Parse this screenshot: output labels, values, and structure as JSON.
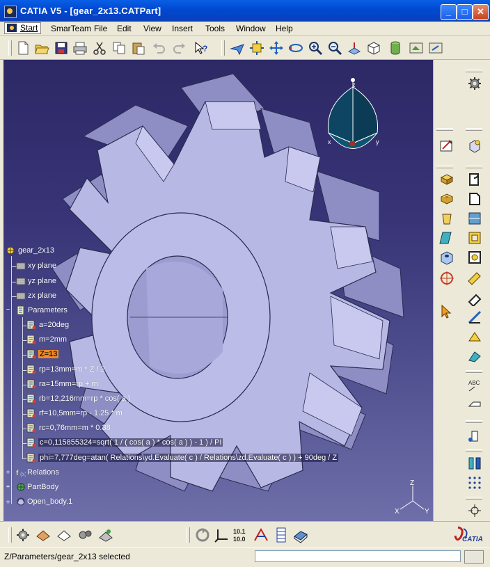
{
  "window": {
    "title": "CATIA V5 - [gear_2x13.CATPart]",
    "minimize": "_",
    "maximize": "□",
    "close": "✕"
  },
  "menubar": {
    "items": [
      "Start",
      "SmarTeam",
      "File",
      "Edit",
      "View",
      "Insert",
      "Tools",
      "Window",
      "Help"
    ],
    "mdi_minimize": "–",
    "mdi_restore": "❐",
    "mdi_close": "✕"
  },
  "toolbar": {
    "icons": [
      "new-icon",
      "open-icon",
      "save-icon",
      "print-icon",
      "cut-icon",
      "copy-icon",
      "paste-icon",
      "undo-icon",
      "redo-icon",
      "whats-this-icon",
      "fly-icon",
      "fit-all-icon",
      "pan-icon",
      "rotate-icon",
      "zoom-in-icon",
      "zoom-out-icon",
      "normal-view-icon",
      "iso-view-icon",
      "render-style-icon",
      "hide-show-icon",
      "swap-space-icon"
    ]
  },
  "tree": {
    "root": "gear_2x13",
    "planes": [
      "xy plane",
      "yz plane",
      "zx plane"
    ],
    "parameters_label": "Parameters",
    "parameters": [
      "a=20deg",
      "m=2mm",
      "Z=13",
      "rp=13mm=m * Z / 2",
      "ra=15mm=rp + m",
      "rb=12,216mm=rp * cos( a )",
      "rf=10,5mm=rp - 1.25 * m",
      "rc=0,76mm=m * 0.38",
      "c=0,115855324=sqrt( 1 / ( cos( a ) * cos( a ) ) - 1 ) / PI",
      "phi=7,777deg=atan(  Relations\\yd.Evaluate( c ) / Relations\\zd.Evaluate( c ) ) + 90deg / Z"
    ],
    "selected_parameter": "Z=13",
    "bottom_nodes": [
      "Relations",
      "PartBody",
      "Open_body.1"
    ]
  },
  "compass": {
    "z": "z",
    "x": "x",
    "y": "y"
  },
  "axis_triad": {
    "z": "Z",
    "x": "X",
    "y": "Y"
  },
  "status": {
    "text": "Z/Parameters/gear_2x13 selected",
    "command_value": ""
  },
  "logo": {
    "text": "CATIA"
  },
  "colors": {
    "title_blue": "#0048d0",
    "viewport_top": "#2d2966",
    "viewport_bottom": "#6e6fa9",
    "gear_face": "#b9b9e6",
    "selection_orange": "#f08a24"
  }
}
